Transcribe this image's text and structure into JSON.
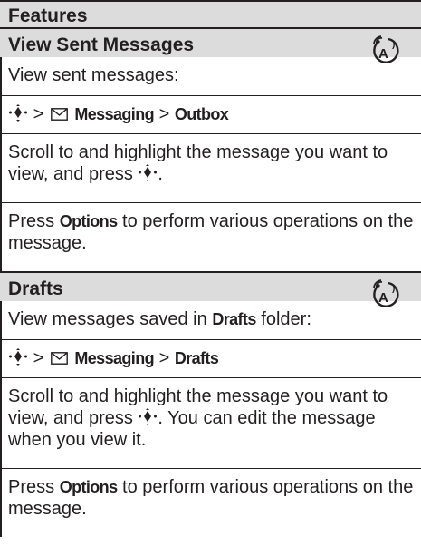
{
  "header": {
    "title": "Features"
  },
  "sections": [
    {
      "title": "View Sent Messages",
      "icon": "network-dependent-feature-icon",
      "intro": "View sent messages:",
      "path": {
        "sep": ">",
        "menu": "Messaging",
        "item": "Outbox"
      },
      "step1_text": "Scroll to and highlight the message you want to view, and press",
      "step1_end": ".",
      "step2_pre": "Press",
      "step2_key": "Options",
      "step2_post": "to perform various operations on the message."
    },
    {
      "title": "Drafts",
      "icon": "network-dependent-feature-icon",
      "intro_pre": "View messages saved in",
      "intro_key": "Drafts",
      "intro_post": "folder:",
      "path": {
        "sep": ">",
        "menu": "Messaging",
        "item": "Drafts"
      },
      "step1_text": "Scroll to and highlight the message you want to view, and press",
      "step1_end": ". You can edit the message when you view it.",
      "step2_pre": "Press",
      "step2_key": "Options",
      "step2_post": "to perform various operations on the message."
    }
  ]
}
